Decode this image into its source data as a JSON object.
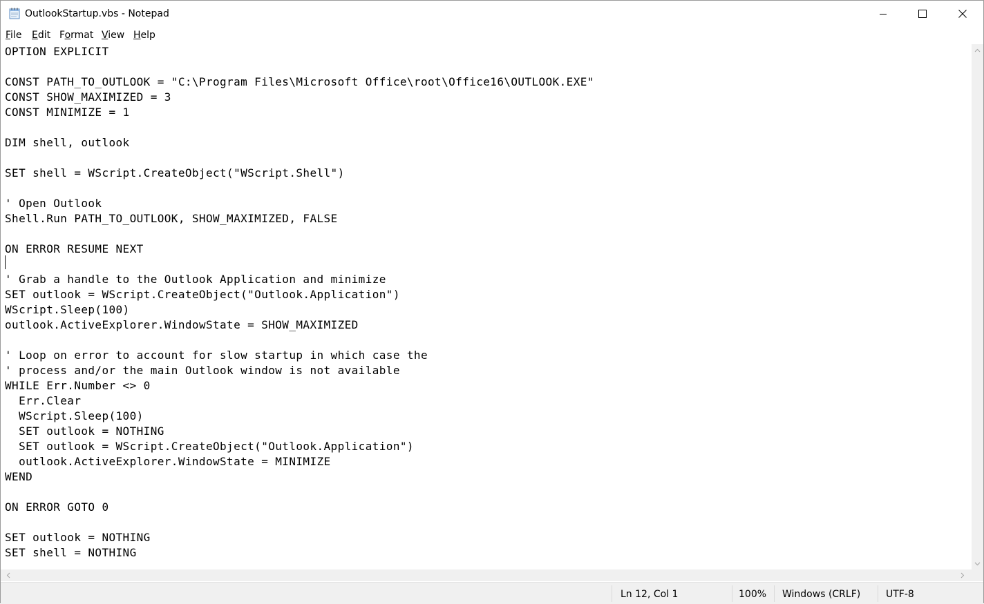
{
  "window": {
    "title": "OutlookStartup.vbs - Notepad",
    "controls": {
      "minimize": "minimize-icon",
      "maximize": "maximize-icon",
      "close": "close-icon"
    }
  },
  "menu": {
    "file": {
      "accel": "F",
      "rest": "ile"
    },
    "edit": {
      "accel": "E",
      "rest": "dit"
    },
    "format_pre": "F",
    "format_accel": "o",
    "format_rest": "rmat",
    "view": {
      "accel": "V",
      "rest": "iew"
    },
    "help": {
      "accel": "H",
      "rest": "elp"
    }
  },
  "editor": {
    "lines": [
      "OPTION EXPLICIT",
      "",
      "CONST PATH_TO_OUTLOOK = \"C:\\Program Files\\Microsoft Office\\root\\Office16\\OUTLOOK.EXE\"",
      "CONST SHOW_MAXIMIZED = 3",
      "CONST MINIMIZE = 1",
      "",
      "DIM shell, outlook",
      "",
      "SET shell = WScript.CreateObject(\"WScript.Shell\")",
      "",
      "' Open Outlook",
      "Shell.Run PATH_TO_OUTLOOK, SHOW_MAXIMIZED, FALSE",
      "",
      "ON ERROR RESUME NEXT",
      "",
      "' Grab a handle to the Outlook Application and minimize",
      "SET outlook = WScript.CreateObject(\"Outlook.Application\")",
      "WScript.Sleep(100)",
      "outlook.ActiveExplorer.WindowState = SHOW_MAXIMIZED",
      "",
      "' Loop on error to account for slow startup in which case the",
      "' process and/or the main Outlook window is not available",
      "WHILE Err.Number <> 0",
      "  Err.Clear",
      "  WScript.Sleep(100)",
      "  SET outlook = NOTHING",
      "  SET outlook = WScript.CreateObject(\"Outlook.Application\")",
      "  outlook.ActiveExplorer.WindowState = MINIMIZE",
      "WEND",
      "",
      "ON ERROR GOTO 0",
      "",
      "SET outlook = NOTHING",
      "SET shell = NOTHING"
    ]
  },
  "status": {
    "position": "Ln 12, Col 1",
    "zoom": "100%",
    "line_ending": "Windows (CRLF)",
    "encoding": "UTF-8"
  }
}
